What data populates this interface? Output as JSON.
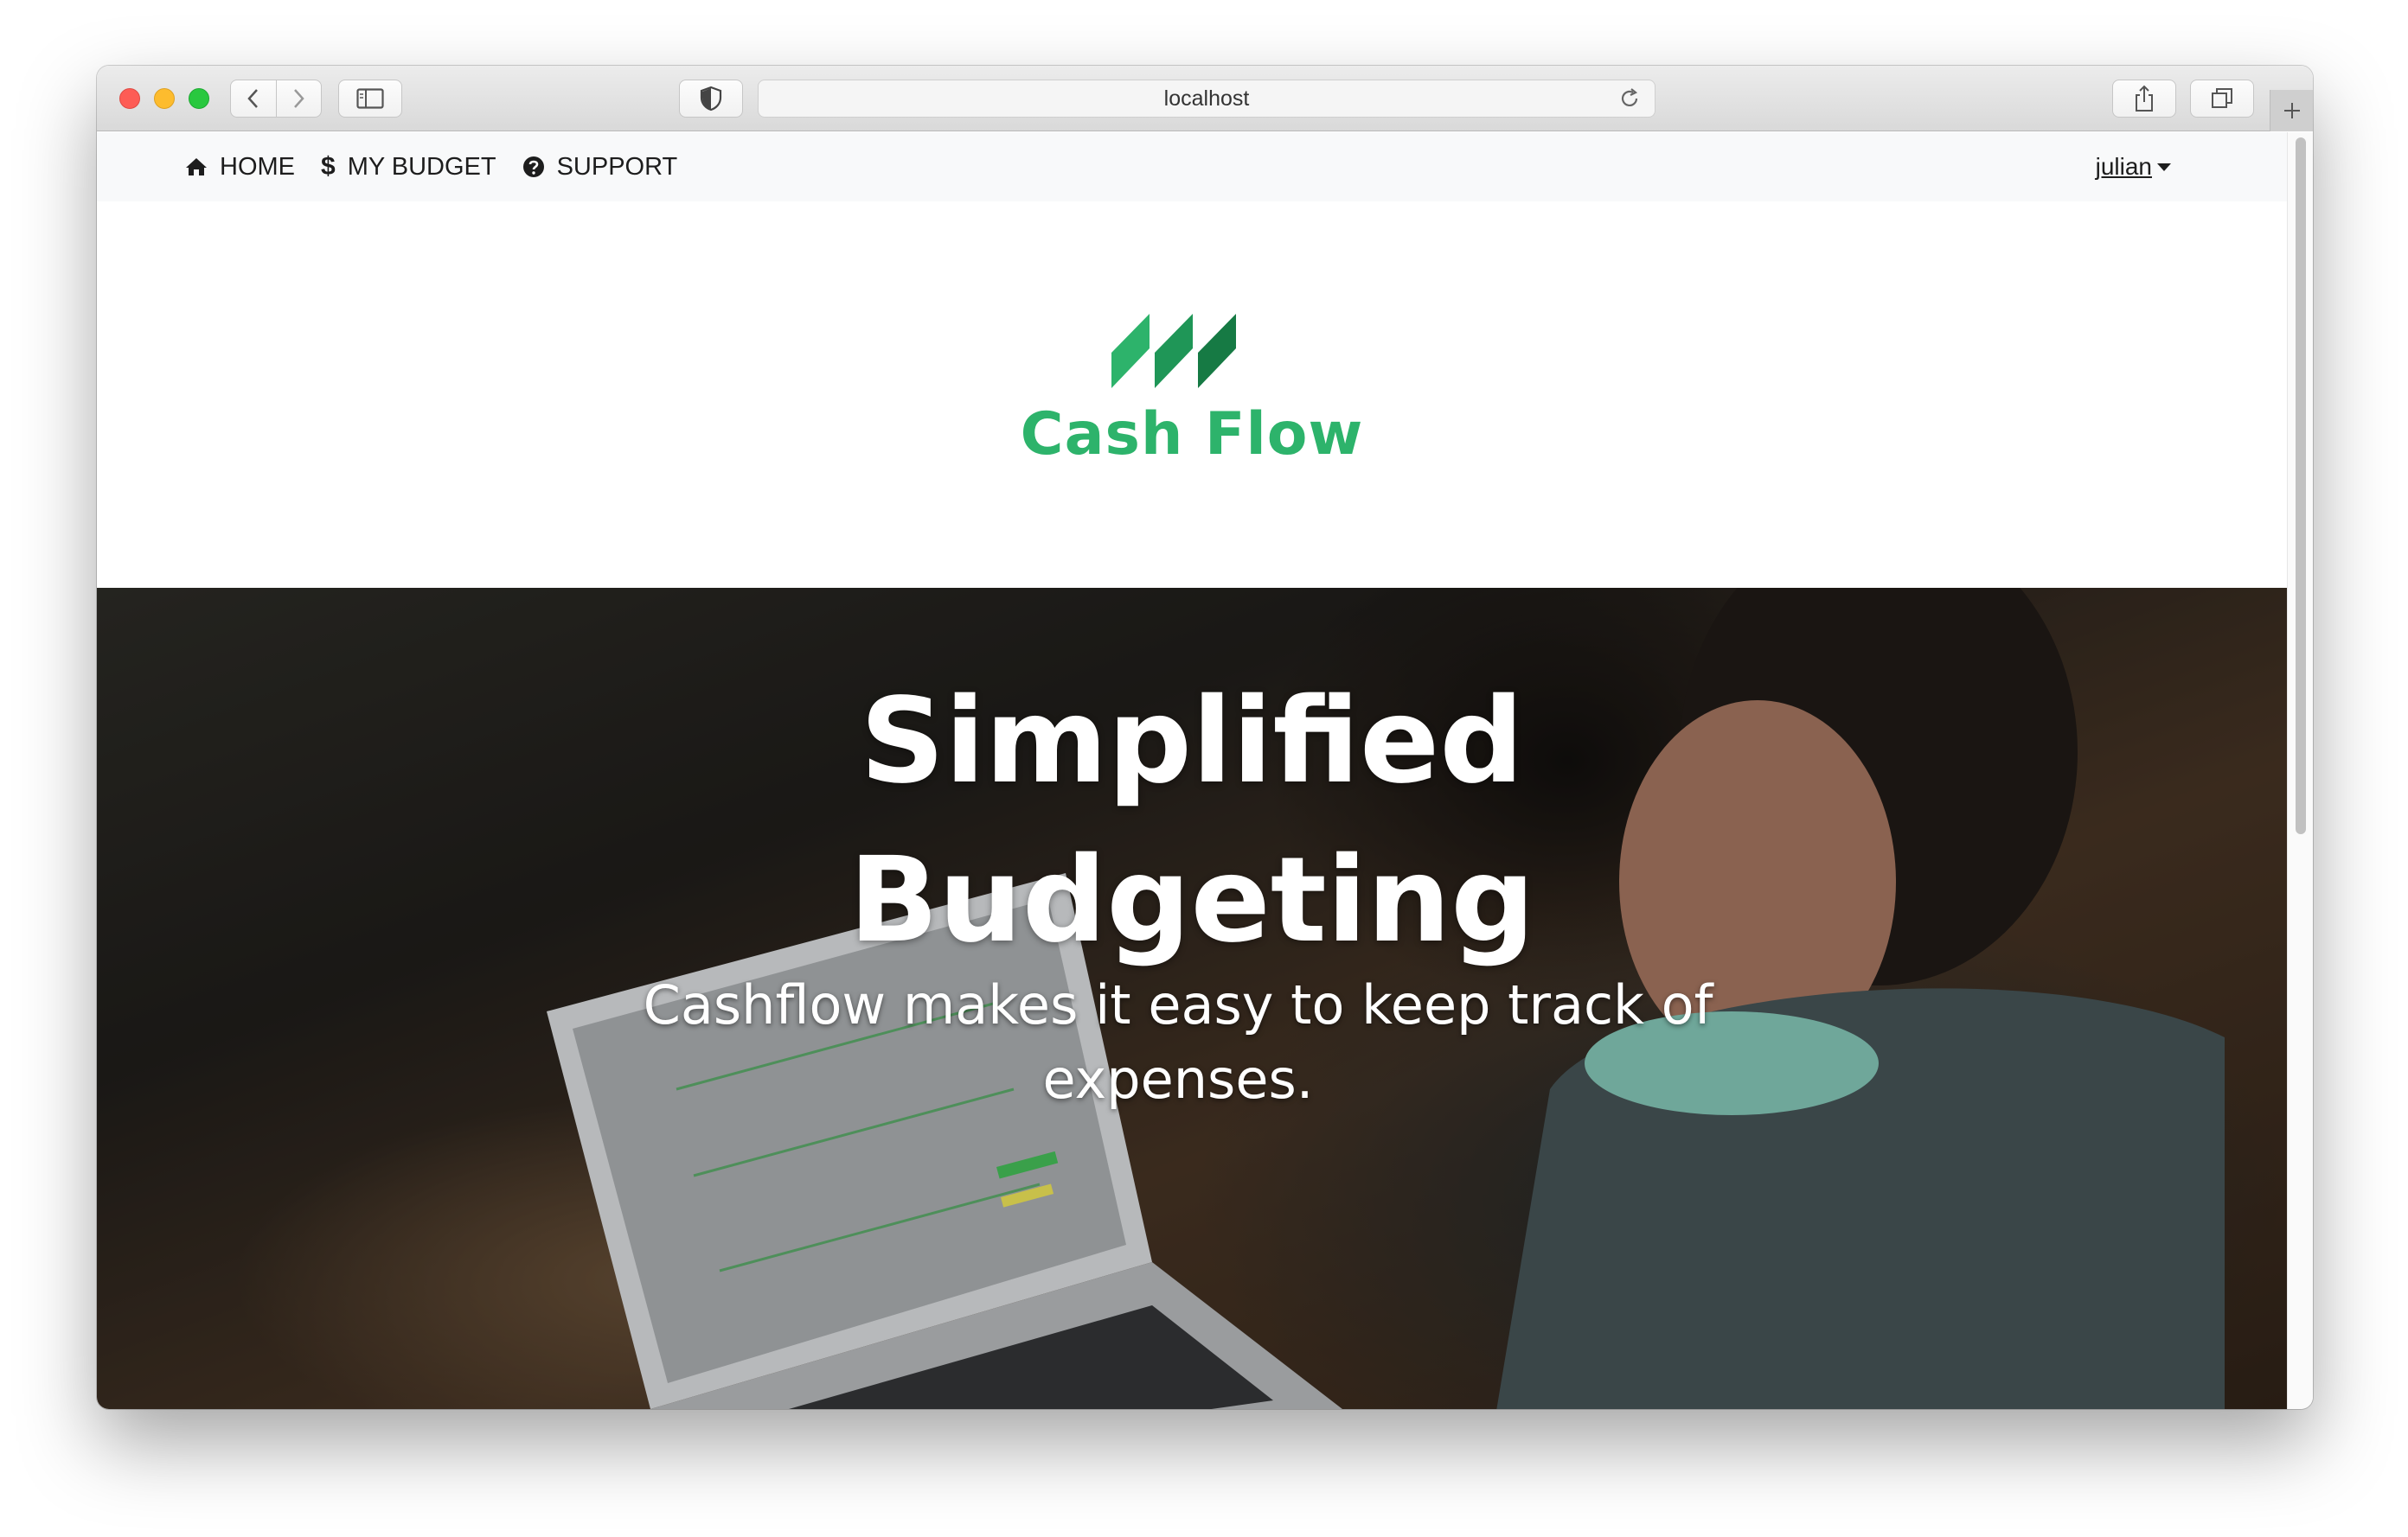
{
  "browser": {
    "address": "localhost"
  },
  "navbar": {
    "links": [
      {
        "label": "HOME",
        "icon": "home-icon"
      },
      {
        "label": "MY BUDGET",
        "icon": "dollar-icon"
      },
      {
        "label": "SUPPORT",
        "icon": "question-circle-icon"
      }
    ],
    "user": "julian"
  },
  "brand": {
    "name": "Cash Flow",
    "color": "#2db36b"
  },
  "hero": {
    "title_line1": "Simplified",
    "title_line2": "Budgeting",
    "subtitle": "Cashflow makes it easy to keep track of expenses."
  }
}
